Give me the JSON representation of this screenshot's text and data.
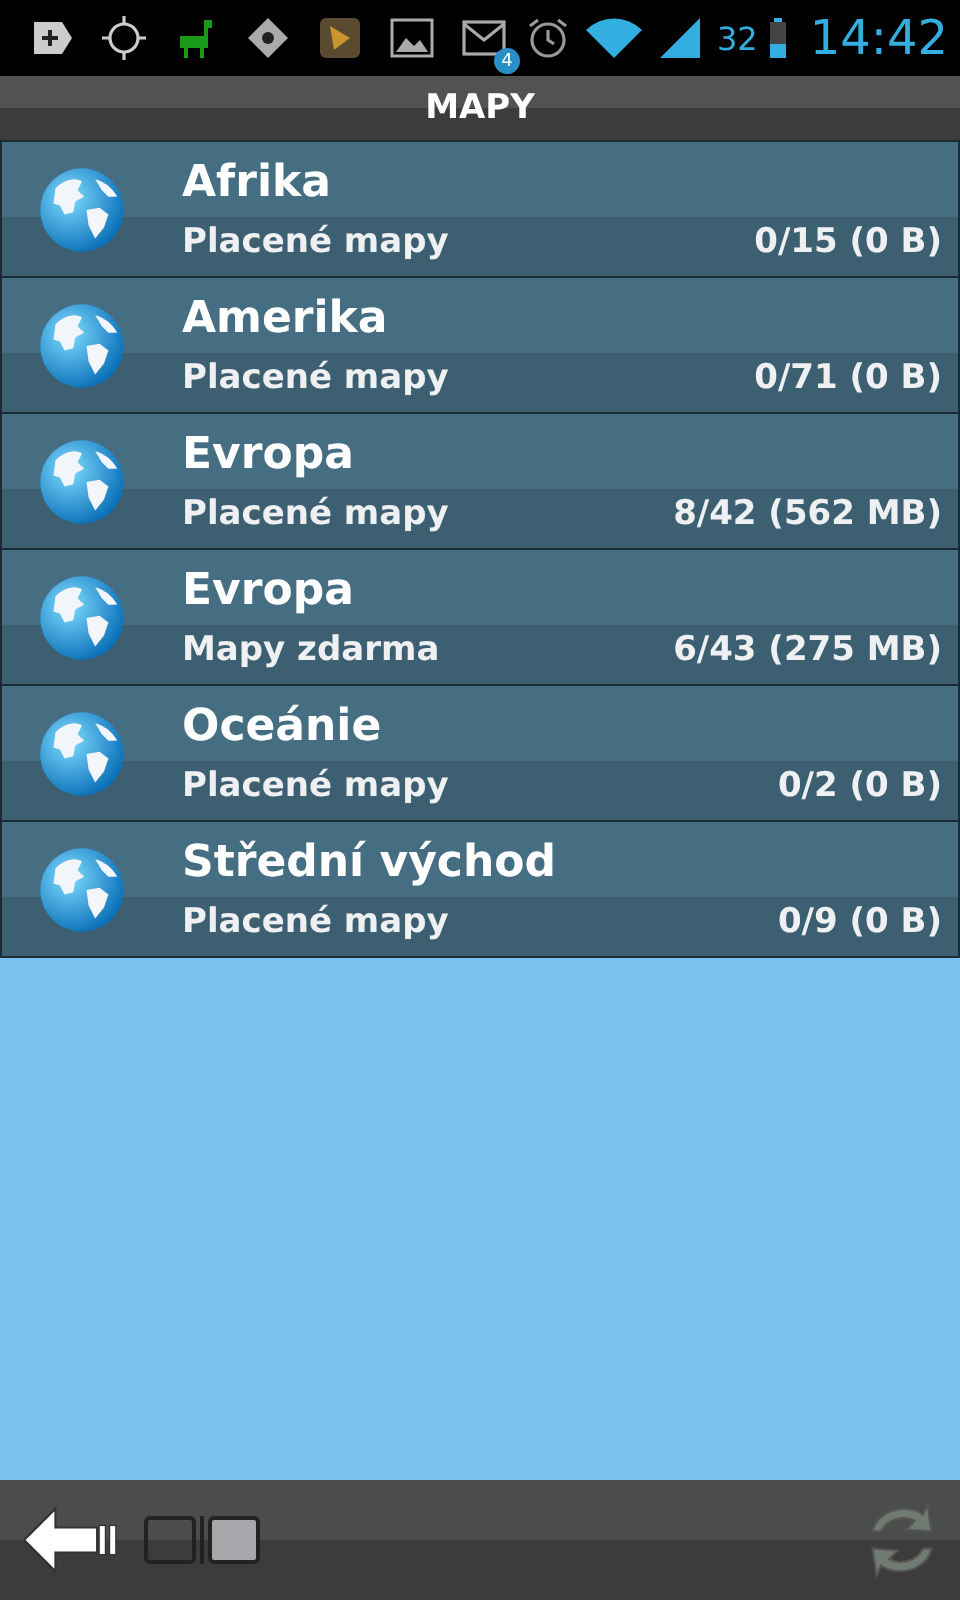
{
  "status_bar": {
    "mail_count": "4",
    "battery": "32",
    "time": "14:42"
  },
  "title": "MAPY",
  "regions": [
    {
      "name": "Afrika",
      "type": "Placené mapy",
      "count": "0/15 (0 B)"
    },
    {
      "name": "Amerika",
      "type": "Placené mapy",
      "count": "0/71 (0 B)"
    },
    {
      "name": "Evropa",
      "type": "Placené mapy",
      "count": "8/42 (562 MB)"
    },
    {
      "name": "Evropa",
      "type": "Mapy zdarma",
      "count": "6/43 (275 MB)"
    },
    {
      "name": "Oceánie",
      "type": "Placené mapy",
      "count": "0/2 (0 B)"
    },
    {
      "name": "Střední východ",
      "type": "Placené mapy",
      "count": "0/9 (0 B)"
    }
  ],
  "pages": [
    {
      "selected": false
    },
    {
      "selected": true
    }
  ],
  "refresh": {
    "disabled": true
  }
}
